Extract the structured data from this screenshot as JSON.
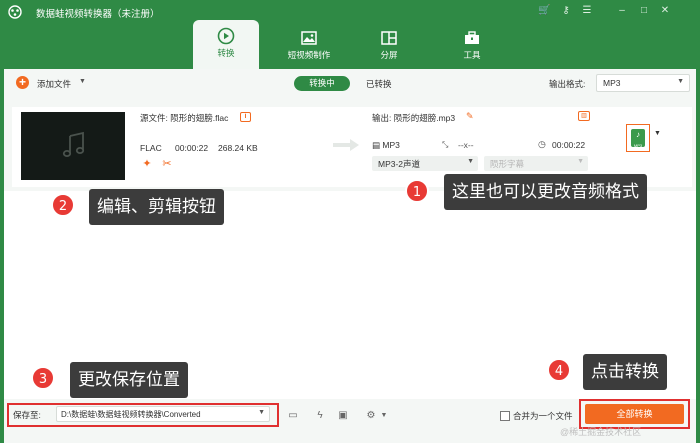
{
  "window": {
    "title": "数据蛙视频转换器（未注册）"
  },
  "nav": {
    "tabs": [
      {
        "label": "转换",
        "icon": "convert-icon",
        "active": true
      },
      {
        "label": "短视频制作",
        "icon": "image-icon",
        "active": false
      },
      {
        "label": "分屏",
        "icon": "split-screen-icon",
        "active": false
      },
      {
        "label": "工具",
        "icon": "toolbox-icon",
        "active": false
      }
    ]
  },
  "toolbar": {
    "add_file_label": "添加文件",
    "segment_converting": "转换中",
    "segment_converted": "已转换",
    "output_format_label": "输出格式:",
    "output_format_value": "MP3"
  },
  "file": {
    "source_label": "源文件: 陨形的翅膀.flac",
    "format": "FLAC",
    "duration": "00:00:22",
    "size": "268.24 KB",
    "output_label": "输出: 陨形的翅膀.mp3",
    "output_format": "MP3",
    "resolution": "--x--",
    "output_duration": "00:00:22",
    "channel_value": "MP3-2声道",
    "subtitle_value": "陨形字幕",
    "format_badge": "MP3"
  },
  "bottom": {
    "save_to_label": "保存至:",
    "save_path": "D:\\数据蛙\\数据蛙视频转换器\\Converted",
    "merge_label": "合并为一个文件",
    "convert_all_label": "全部转换"
  },
  "callouts": [
    {
      "num": "1",
      "text": "这里也可以更改音频格式"
    },
    {
      "num": "2",
      "text": "编辑、剪辑按钮"
    },
    {
      "num": "3",
      "text": "更改保存位置"
    },
    {
      "num": "4",
      "text": "点击转换"
    }
  ],
  "watermark": "@稀土掘金技术社区",
  "colors": {
    "brand_green": "#2f8a45",
    "accent_orange": "#f26a21",
    "highlight_red": "#e03030"
  }
}
